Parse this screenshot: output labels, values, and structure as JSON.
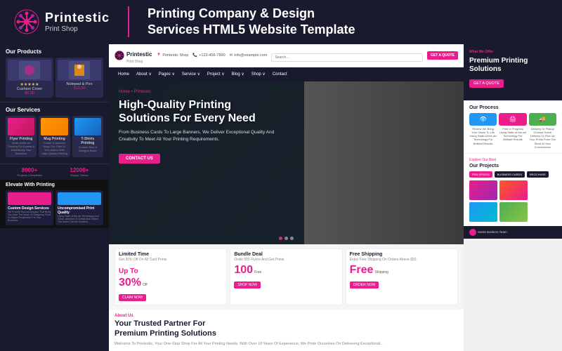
{
  "header": {
    "logo_name": "Printestic",
    "logo_sub": "Print Shop",
    "divider": true,
    "tagline": "Printing Company & Design\nServices  HTML5 Website Template"
  },
  "mini_nav": {
    "logo_name": "Printestic",
    "logo_sub": "Print Shop",
    "location": "Printestic Shop",
    "phone": "+123-456-7890",
    "email": "info@example.com",
    "search_placeholder": "Search...",
    "quote_btn": "GET A QUOTE"
  },
  "nav": {
    "items": [
      "Home",
      "About ∨",
      "Pages ∨",
      "Service ∨",
      "Project ∨",
      "Blog ∨",
      "Shop ∨",
      "Contact"
    ]
  },
  "left_panel": {
    "products_title": "Our Products",
    "products": [
      {
        "name": "Cushion Cover",
        "price": "$6.00"
      },
      {
        "name": "Notepad & Pen",
        "price": "$12.00"
      }
    ],
    "services_title": "Our Services",
    "services": [
      {
        "name": "Flyer Printing",
        "desc": "State-of-the-art Printing For Events &\nAdvertising Your Business"
      },
      {
        "name": "Mug Printing",
        "desc": "Create Customize Mugs For Gifts Or\nYour Brand With High-Quality Printing"
      },
      {
        "name": "T-Shirts Printing",
        "desc": "Custom Size &\nDesigns Made"
      }
    ],
    "stats": [
      {
        "num": "8000+",
        "label": "Projects Completed"
      },
      {
        "num": "12000+",
        "label": "Happy Clients"
      }
    ],
    "elevate_title": "Elevate With Printing",
    "elevate_cards": [
      {
        "title": "Custom Design Services",
        "desc": "We Provide Special Designs That Bring You\nAlive The Ideas Of Designing From A Unique\nPerspective For Your Business"
      },
      {
        "title": "Uncompromised Print Quality",
        "desc": "Using State-of-the-art Technology And Close-\nAttention To Detail And Deliver The Same\nCan Be Creative..."
      }
    ]
  },
  "hero": {
    "breadcrumb": "Home • Printestic",
    "title": "High-Quality Printing\nSolutions For Every Need",
    "desc": "From Business Cards To Large Banners, We Deliver Exceptional Quality And\nCreativity To Meet All Your Printing Requirements.",
    "cta_btn": "CONTACT US",
    "dots": [
      true,
      false,
      false
    ]
  },
  "deals": [
    {
      "title": "Limited Time",
      "desc": "Get 30% Off On All Card\nPrints",
      "highlight": "Up To",
      "amount": "30%",
      "amount_label": "Off",
      "btn": "CLAIM NOW"
    },
    {
      "title": "Bundle Deal",
      "desc": "Order 555 Flyers And Get\nPrints",
      "highlight": "100",
      "amount_label": "Free",
      "btn": "SHOP NOW"
    },
    {
      "title": "Free Shipping",
      "desc": "Enjoy Free Shipping On\nOrders Above $50.",
      "highlight": "Free",
      "amount_label": "Shipping",
      "btn": "ORDER NOW"
    }
  ],
  "about": {
    "label": "About Us",
    "title": "Your Trusted Partner For\nPremium Printing Solutions",
    "text": "Welcome To Printestic, Your One-Stop Shop For All Your Printing Needs. With\nOver 10 Years Of Experience, We Pride Ourselves On Delivering Exceptional..."
  },
  "right_panel": {
    "premium_title": "Premium Printing\nSolutions",
    "premium_btn": "GET A QUOTE",
    "process_title": "Our Process",
    "steps": [
      {
        "icon": "👁",
        "name": "Review\nWe Bring Your Vision To Life\nUsing State-of-the-art\nTechnology For Brilliant Results"
      },
      {
        "icon": "🖨",
        "name": "Print In Progress\nUsing State-of-the-art\nTechnology For Brilliant Results"
      },
      {
        "icon": "🚚",
        "name": "Delivery Or Pickup\nChoose Home Delivery Or Pick Up\nYour Prints From Our Store At\nYour Convenience"
      }
    ],
    "projects_title": "Our Projects",
    "projects_label": "Explore Our Best",
    "project_tags": [
      "PEN DESIGN",
      "BUSINESS CARDS",
      "BROCHURE"
    ],
    "persons_label": "Santa Bonkers Team"
  }
}
